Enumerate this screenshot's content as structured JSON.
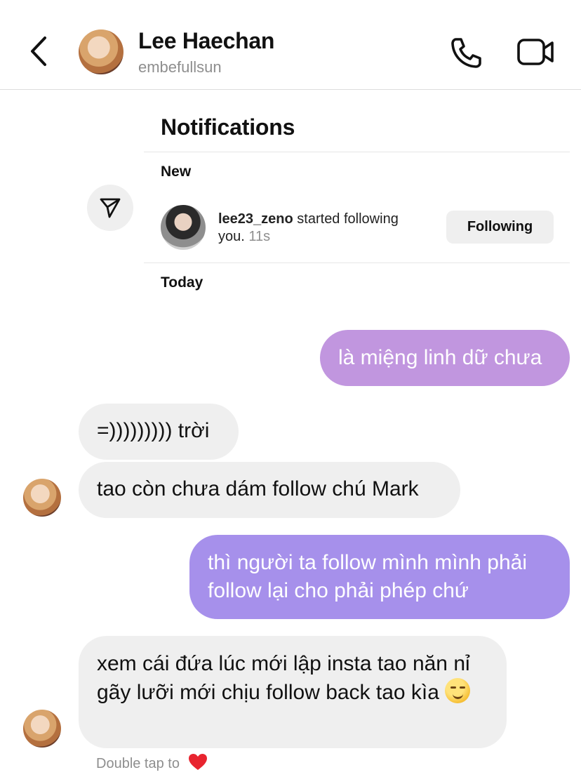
{
  "header": {
    "contact_name": "Lee Haechan",
    "contact_username": "embefullsun",
    "icons": {
      "back": "chevron-left-icon",
      "call": "phone-icon",
      "video": "video-camera-icon"
    }
  },
  "shared_post": {
    "title": "Notifications",
    "sections": {
      "new": "New",
      "today": "Today"
    },
    "notification": {
      "username": "lee23_zeno",
      "action": " started following you.",
      "time": " 11s",
      "button_label": "Following"
    },
    "share_icon": "paper-plane-icon"
  },
  "messages": [
    {
      "direction": "outgoing",
      "text": "là miệng linh dữ chưa"
    },
    {
      "direction": "incoming",
      "text": "=))))))))) trời"
    },
    {
      "direction": "incoming",
      "text": "tao còn chưa dám follow chú Mark"
    },
    {
      "direction": "outgoing",
      "text": "thì người ta follow mình mình phải follow lại cho phải phép chứ"
    },
    {
      "direction": "incoming",
      "text": "xem cái đứa lúc mới lập insta tao năn nỉ gãy lưỡi mới chịu follow back tao kìa",
      "emoji": "smirking-face-emoji"
    }
  ],
  "hint": {
    "text": "Double tap to",
    "icon": "red-heart-icon"
  },
  "colors": {
    "outgoing_bubble_1": "#c196df",
    "outgoing_bubble_2": "#a690eb",
    "incoming_bubble": "#efefef",
    "secondary_text": "#8e8e8e"
  }
}
